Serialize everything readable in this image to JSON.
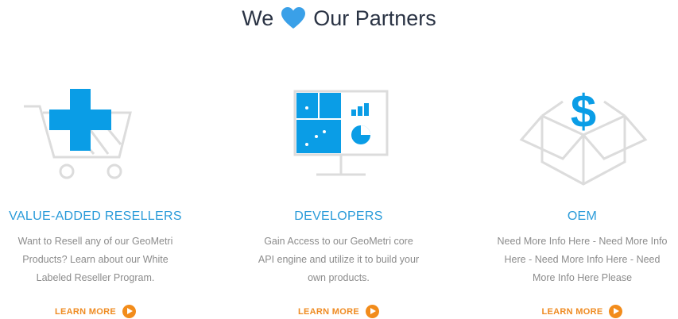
{
  "header": {
    "title_left": "We",
    "title_right": "Our Partners",
    "heart_color": "#3aa0e8"
  },
  "partners": [
    {
      "icon": "shopping-cart-plus-icon",
      "title": "VALUE-ADDED RESELLERS",
      "description_lines": [
        "Want to Resell any of our GeoMetri",
        "Products? Learn about our White",
        "Labeled Reseller Program."
      ],
      "cta": "LEARN MORE"
    },
    {
      "icon": "dashboard-monitor-icon",
      "title": "DEVELOPERS",
      "description_lines": [
        "Gain Access to our GeoMetri core",
        "API engine and utilize it to build your",
        "own products."
      ],
      "cta": "LEARN MORE"
    },
    {
      "icon": "dollar-box-icon",
      "title": "OEM",
      "description_lines": [
        "Need More Info Here - Need More Info",
        "Here - Need More Info Here - Need",
        "More Info Here Please"
      ],
      "cta": "LEARN MORE"
    }
  ],
  "colors": {
    "accent_blue": "#0a9de6",
    "heading_blue": "#2a9bd9",
    "cta_orange": "#f28c1b",
    "outline_gray": "#dcdcdc"
  }
}
